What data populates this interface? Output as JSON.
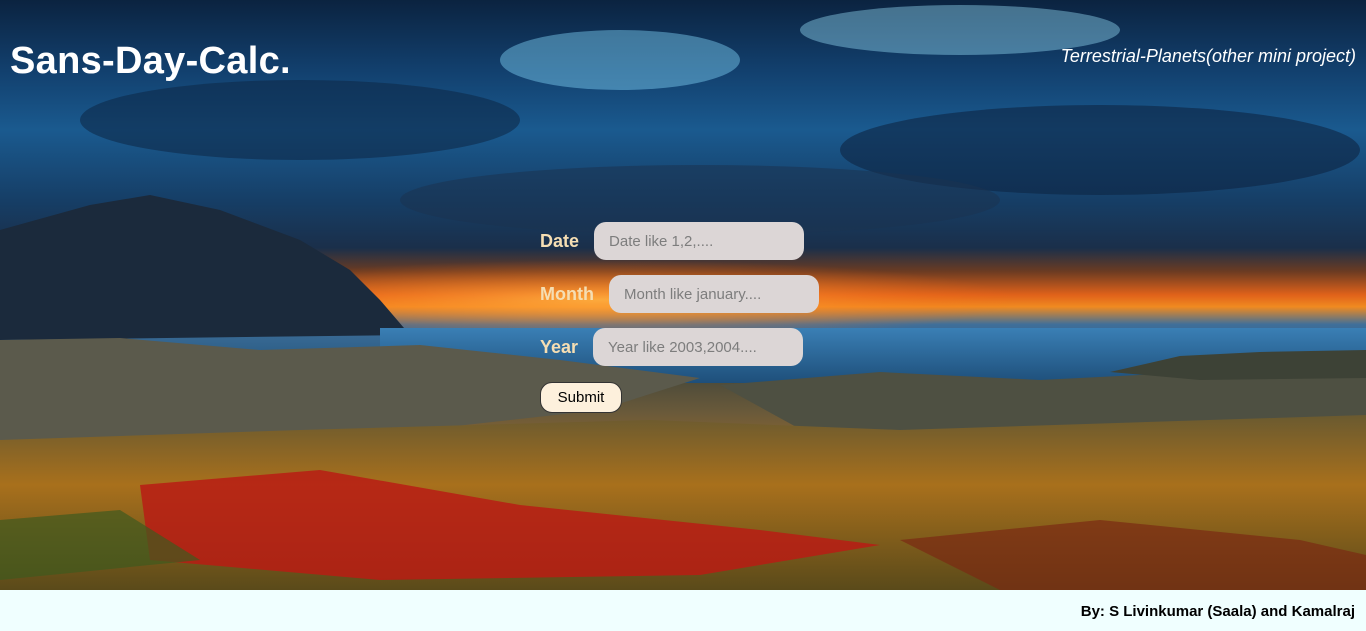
{
  "header": {
    "title": "Sans-Day-Calc.",
    "other_project_link": "Terrestrial-Planets(other mini project)"
  },
  "form": {
    "date": {
      "label": "Date",
      "placeholder": "Date like 1,2,...."
    },
    "month": {
      "label": "Month",
      "placeholder": "Month like january...."
    },
    "year": {
      "label": "Year",
      "placeholder": "Year like 2003,2004...."
    },
    "submit_label": "Submit"
  },
  "footer": {
    "credits": "By: S Livinkumar (Saala) and Kamalraj"
  },
  "colors": {
    "label_color": "#f5deb3",
    "input_background": "#dcd6d6",
    "button_background": "#fdf0dc",
    "footer_background": "#f0ffff"
  }
}
